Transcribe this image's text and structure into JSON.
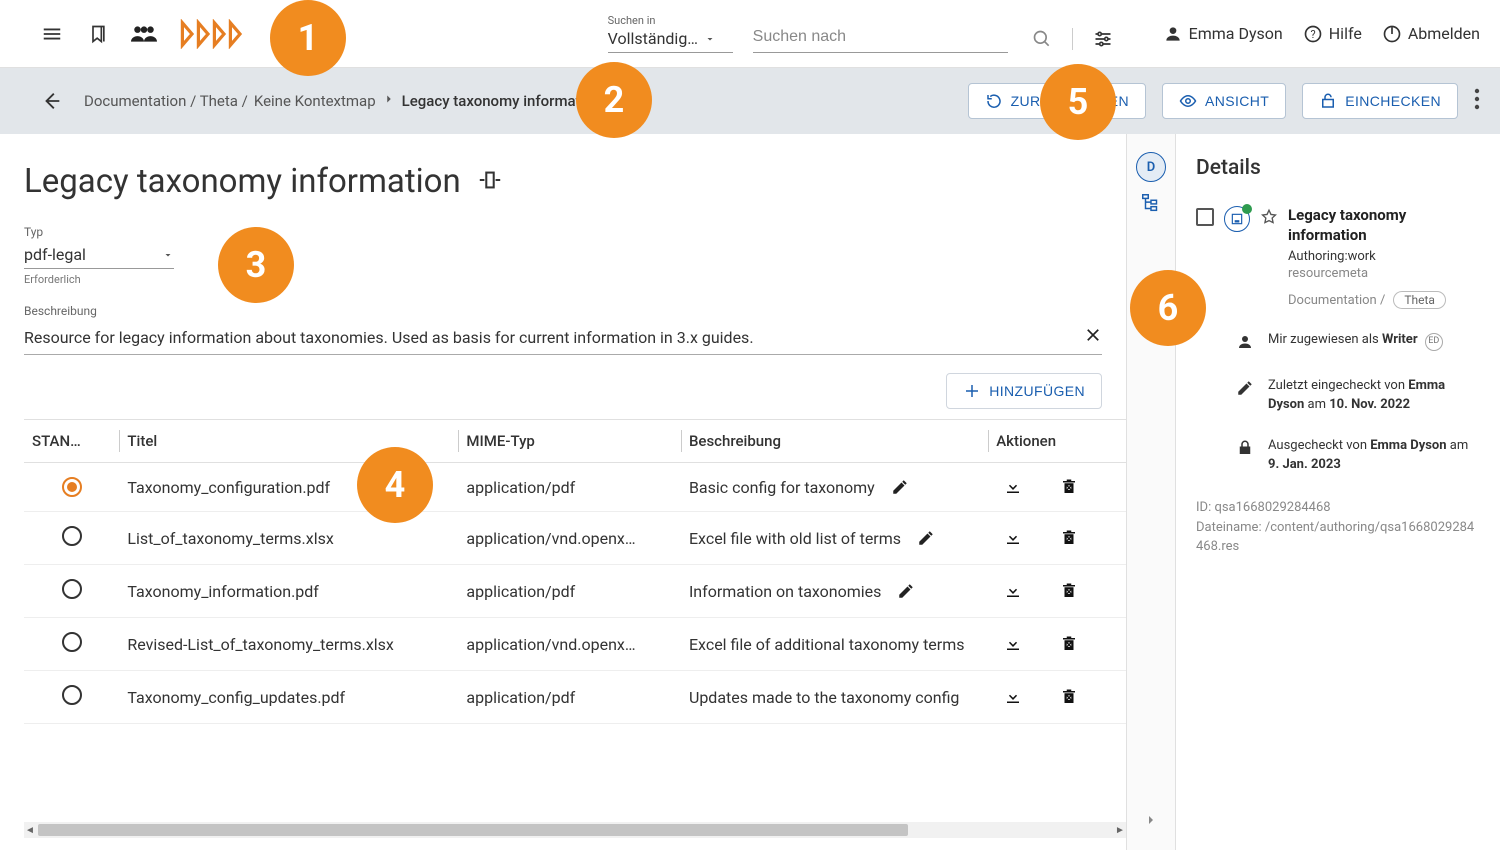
{
  "header": {
    "search_in_label": "Suchen in",
    "search_in_value": "Vollständig…",
    "search_placeholder": "Suchen nach",
    "user_name": "Emma Dyson",
    "help_label": "Hilfe",
    "logout_label": "Abmelden"
  },
  "breadcrumb": {
    "path_prefix": "Documentation / Theta /",
    "no_contextmap": "Keine Kontextmap",
    "current": "Legacy taxonomy information"
  },
  "actions": {
    "reset": "ZURÜCKSETZEN",
    "view": "ANSICHT",
    "checkin": "EINCHECKEN"
  },
  "page": {
    "title": "Legacy taxonomy information",
    "type_label": "Typ",
    "type_value": "pdf-legal",
    "type_helper": "Erforderlich",
    "desc_label": "Beschreibung",
    "desc_value": "Resource for legacy information about taxonomies. Used as basis for current information in 3.x guides.",
    "add_label": "HINZUFÜGEN"
  },
  "table": {
    "headers": {
      "standard": "STAN…",
      "title": "Titel",
      "mime": "MIME-Typ",
      "desc": "Beschreibung",
      "actions": "Aktionen"
    },
    "rows": [
      {
        "selected": true,
        "title": "Taxonomy_configuration.pdf",
        "mime": "application/pdf",
        "desc": "Basic config for taxonomy",
        "editable": true
      },
      {
        "selected": false,
        "title": "List_of_taxonomy_terms.xlsx",
        "mime": "application/vnd.openx…",
        "desc": "Excel file with old list of terms",
        "editable": true
      },
      {
        "selected": false,
        "title": "Taxonomy_information.pdf",
        "mime": "application/pdf",
        "desc": "Information on taxonomies",
        "editable": true
      },
      {
        "selected": false,
        "title": "Revised-List_of_taxonomy_terms.xlsx",
        "mime": "application/vnd.openx…",
        "desc": "Excel file of additional taxonomy terms",
        "editable": false
      },
      {
        "selected": false,
        "title": "Taxonomy_config_updates.pdf",
        "mime": "application/pdf",
        "desc": "Updates made to the taxonomy config",
        "editable": false
      }
    ]
  },
  "details": {
    "heading": "Details",
    "item_title": "Legacy taxonomy information",
    "status": "Authoring:work",
    "type": "resourcemeta",
    "path_prefix": "Documentation /",
    "path_chip": "Theta",
    "assigned_prefix": "Mir zugewiesen als ",
    "assigned_role": "Writer",
    "assigned_initials": "ED",
    "last_checkin_prefix": "Zuletzt eingecheckt von ",
    "last_checkin_user": "Emma Dyson",
    "last_checkin_on": " am ",
    "last_checkin_date": "10. Nov. 2022",
    "checkout_prefix": "Ausgecheckt von ",
    "checkout_user": "Emma Dyson",
    "checkout_on": " am ",
    "checkout_date": "9. Jan. 2023",
    "id_label": "ID: ",
    "id_value": "qsa1668029284468",
    "filename_label": "Dateiname: ",
    "filename_value": "/content/authoring/qsa1668029284468.res"
  },
  "rail": {
    "tab_letter": "D"
  },
  "annotations": [
    "1",
    "2",
    "3",
    "4",
    "5",
    "6"
  ]
}
